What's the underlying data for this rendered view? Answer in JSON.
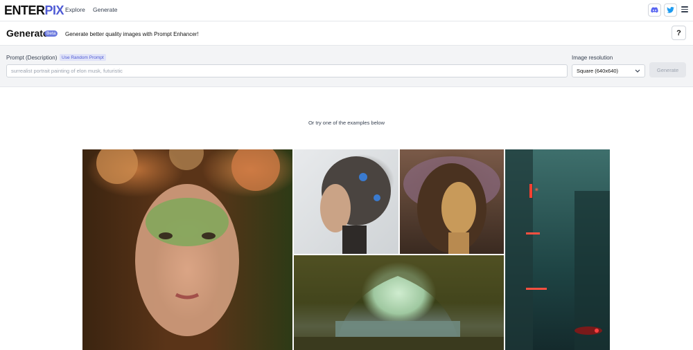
{
  "app": {
    "logo_main": "ENTER",
    "logo_accent": "PIX"
  },
  "nav": {
    "explore": "Explore",
    "generate": "Generate",
    "discord_icon": "discord-icon",
    "twitter_icon": "twitter-icon",
    "menu_icon": "hamburger-menu-icon"
  },
  "header": {
    "title": "Generate",
    "badge": "Beta",
    "subtitle": "Generate better quality images with Prompt Enhancer!",
    "help": "?"
  },
  "form": {
    "prompt_label": "Prompt (Description)",
    "random_prompt": "Use Random Prompt",
    "prompt_placeholder": "surrealist portrait painting of elon musk, futuristic",
    "resolution_label": "Image resolution",
    "resolution_value": "Square (640x640)",
    "generate_button": "Generate"
  },
  "examples": {
    "intro": "Or try one of the examples below",
    "items": [
      {
        "subject": "green-masked woman with flower crown portrait"
      },
      {
        "subject": "robotic woman profile"
      },
      {
        "subject": "art nouveau man portrait"
      },
      {
        "subject": "cyberpunk city in rain"
      },
      {
        "subject": "fantasy cave landscape with lake"
      }
    ]
  },
  "colors": {
    "accent": "#4f5bd5",
    "badge": "#6d7bde",
    "panel_bg": "#f3f4f6"
  }
}
